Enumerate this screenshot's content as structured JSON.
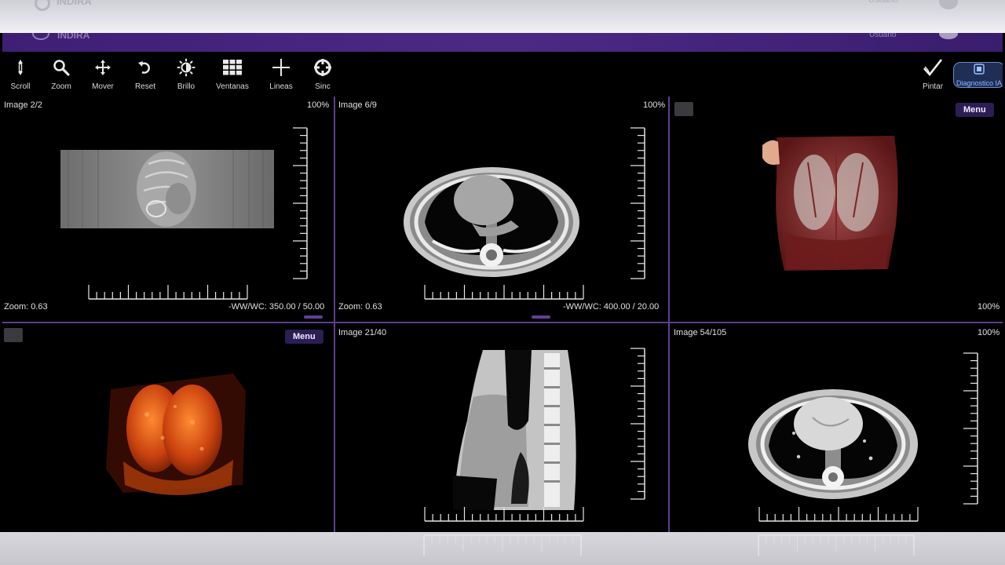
{
  "ghost": {
    "brand": "INDIRA",
    "user": "Usuario"
  },
  "toolbar": {
    "scroll": "Scroll",
    "zoom": "Zoom",
    "mover": "Mover",
    "reset": "Reset",
    "brillo": "Brillo",
    "ventanas": "Ventanas",
    "lineas": "Lineas",
    "sinc": "Sinc",
    "pintar": "Pintar",
    "diagnostico": "Diagnostico IA"
  },
  "panels": {
    "p1": {
      "image": "Image 2/2",
      "percent": "100%",
      "zoom": "Zoom: 0.63",
      "wwwc": "-WW/WC: 350.00 / 50.00"
    },
    "p2": {
      "image": "Image 6/9",
      "percent": "100%",
      "zoom": "Zoom: 0.63",
      "wwwc": "-WW/WC: 400.00 / 20.00"
    },
    "p3": {
      "menu": "Menu",
      "percent": "100%"
    },
    "p4": {
      "menu": "Menu"
    },
    "p5": {
      "image": "Image 21/40"
    },
    "p6": {
      "image": "Image 54/105",
      "percent": "100%"
    }
  },
  "colors": {
    "accent": "#4b2a86",
    "divider": "#5c3f8f",
    "menu_bg": "#2c1e55"
  }
}
